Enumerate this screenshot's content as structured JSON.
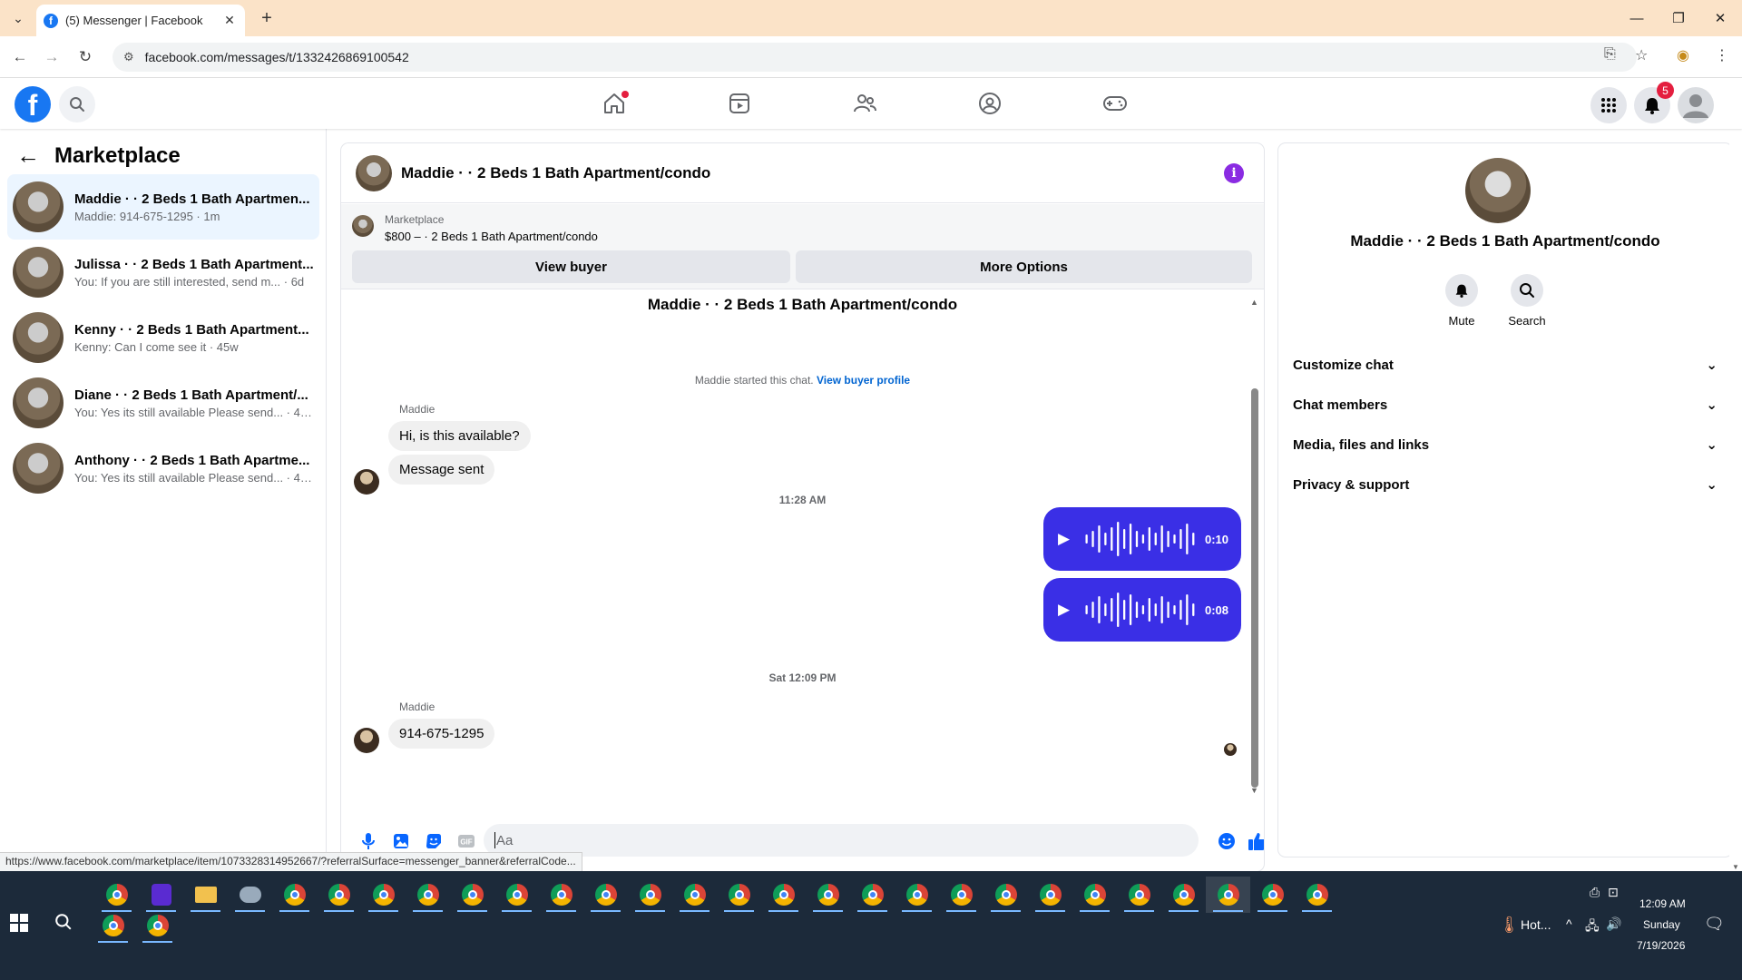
{
  "browser": {
    "tab_title": "(5) Messenger | Facebook",
    "url": "facebook.com/messages/t/1332426869100542",
    "status_link": "https://www.facebook.com/marketplace/item/1073328314952667/?referralSurface=messenger_banner&referralCode..."
  },
  "header": {
    "notification_count": "5"
  },
  "left": {
    "title": "Marketplace",
    "conversations": [
      {
        "name": "Maddie · · 2 Beds 1 Bath Apartmen...",
        "snippet": "Maddie: 914-675-1295 · 1m",
        "active": true
      },
      {
        "name": "Julissa · · 2 Beds 1 Bath Apartment...",
        "snippet": "You: If you are still interested, send m...  · 6d",
        "active": false
      },
      {
        "name": "Kenny · · 2 Beds 1 Bath Apartment...",
        "snippet": "Kenny: Can I come see it · 45w",
        "active": false
      },
      {
        "name": "Diane · · 2 Beds 1 Bath Apartment/...",
        "snippet": "You: Yes its still available Please send... · 45w",
        "active": false
      },
      {
        "name": "Anthony · · 2 Beds 1 Bath Apartme...",
        "snippet": "You: Yes its still available Please send... · 45w",
        "active": false
      }
    ]
  },
  "chat": {
    "title": "Maddie · · 2 Beds 1 Bath Apartment/condo",
    "banner_label": "Marketplace",
    "banner_price": "$800 – · 2 Beds 1 Bath Apartment/condo",
    "view_buyer": "View buyer",
    "more_options": "More Options",
    "intro_title": "Maddie · · 2 Beds 1 Bath Apartment/condo",
    "intro_note": "Maddie started this chat.",
    "intro_link": "View buyer profile",
    "sender1": "Maddie",
    "msg1": "Hi, is this available?",
    "msg2": "Message sent",
    "time1": "11:28 AM",
    "voice1_duration": "0:10",
    "voice2_duration": "0:08",
    "time2": "Sat 12:09 PM",
    "sender2": "Maddie",
    "msg3": "914-675-1295",
    "composer_placeholder": "Aa"
  },
  "right": {
    "name": "Maddie · · 2 Beds 1 Bath Apartment/condo",
    "mute": "Mute",
    "search": "Search",
    "sections": [
      "Customize chat",
      "Chat members",
      "Media, files and links",
      "Privacy & support"
    ]
  },
  "taskbar": {
    "weather": "Hot...",
    "time": "12:09 AM",
    "day": "Sunday",
    "date": "7/19/2026"
  }
}
